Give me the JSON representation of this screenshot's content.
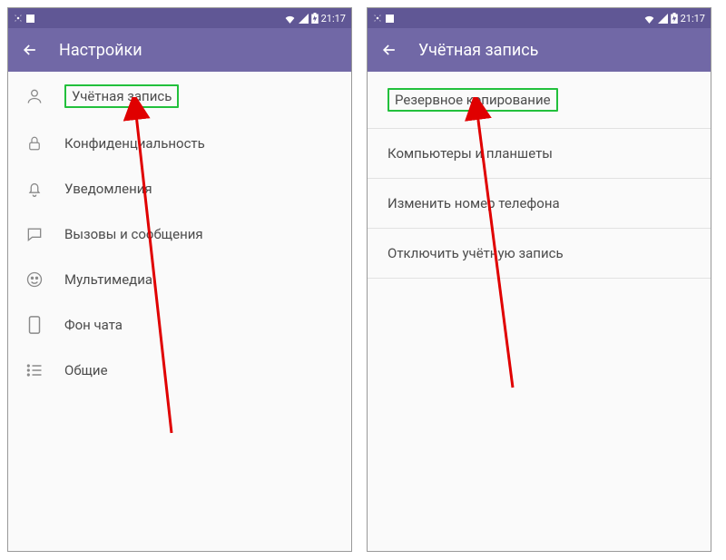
{
  "status": {
    "time": "21:17"
  },
  "screen1": {
    "title": "Настройки",
    "items": [
      {
        "label": "Учётная запись",
        "icon": "user",
        "highlight": true
      },
      {
        "label": "Конфиденциальность",
        "icon": "lock"
      },
      {
        "label": "Уведомления",
        "icon": "bell"
      },
      {
        "label": "Вызовы и сообщения",
        "icon": "chat"
      },
      {
        "label": "Мультимедиа",
        "icon": "media"
      },
      {
        "label": "Фон чата",
        "icon": "phone-bg"
      },
      {
        "label": "Общие",
        "icon": "list"
      }
    ]
  },
  "screen2": {
    "title": "Учётная запись",
    "items": [
      {
        "label": "Резервное копирование",
        "highlight": true
      },
      {
        "label": "Компьютеры и планшеты"
      },
      {
        "label": "Изменить номер телефона"
      },
      {
        "label": "Отключить учётную запись"
      }
    ]
  }
}
